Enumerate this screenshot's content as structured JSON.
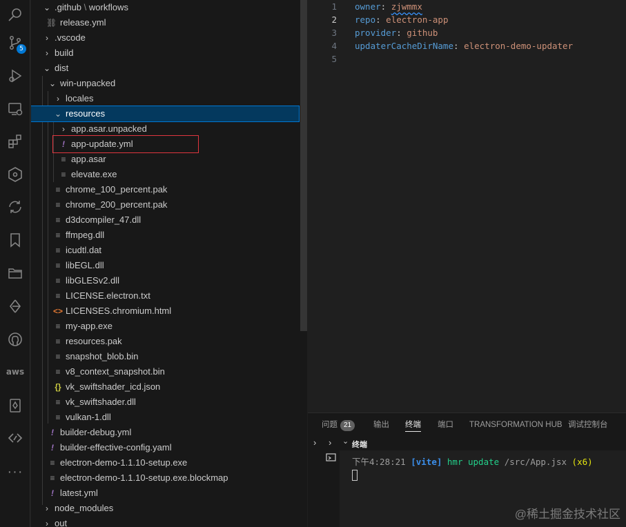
{
  "activity_bar": {
    "scm_badge": "5",
    "aws_label": "aws",
    "more_label": "···"
  },
  "explorer": {
    "rows": [
      {
        "label": ".github",
        "sep": "\\",
        "label2": "workflows",
        "icon": "chevron-down"
      },
      {
        "label": "release.yml",
        "icon": "link"
      },
      {
        "label": ".vscode",
        "icon": "chevron-right"
      },
      {
        "label": "build",
        "icon": "chevron-right"
      },
      {
        "label": "dist",
        "icon": "chevron-down"
      },
      {
        "label": "win-unpacked",
        "icon": "chevron-down"
      },
      {
        "label": "locales",
        "icon": "chevron-right"
      },
      {
        "label": "resources",
        "icon": "chevron-down"
      },
      {
        "label": "app.asar.unpacked",
        "icon": "chevron-right"
      },
      {
        "label": "app-update.yml",
        "icon": "yml"
      },
      {
        "label": "app.asar",
        "icon": "file"
      },
      {
        "label": "elevate.exe",
        "icon": "file"
      },
      {
        "label": "chrome_100_percent.pak",
        "icon": "file"
      },
      {
        "label": "chrome_200_percent.pak",
        "icon": "file"
      },
      {
        "label": "d3dcompiler_47.dll",
        "icon": "file"
      },
      {
        "label": "ffmpeg.dll",
        "icon": "file"
      },
      {
        "label": "icudtl.dat",
        "icon": "file"
      },
      {
        "label": "libEGL.dll",
        "icon": "file"
      },
      {
        "label": "libGLESv2.dll",
        "icon": "file"
      },
      {
        "label": "LICENSE.electron.txt",
        "icon": "file"
      },
      {
        "label": "LICENSES.chromium.html",
        "icon": "html"
      },
      {
        "label": "my-app.exe",
        "icon": "file"
      },
      {
        "label": "resources.pak",
        "icon": "file"
      },
      {
        "label": "snapshot_blob.bin",
        "icon": "file"
      },
      {
        "label": "v8_context_snapshot.bin",
        "icon": "file"
      },
      {
        "label": "vk_swiftshader_icd.json",
        "icon": "json"
      },
      {
        "label": "vk_swiftshader.dll",
        "icon": "file"
      },
      {
        "label": "vulkan-1.dll",
        "icon": "file"
      },
      {
        "label": "builder-debug.yml",
        "icon": "yml"
      },
      {
        "label": "builder-effective-config.yaml",
        "icon": "yml"
      },
      {
        "label": "electron-demo-1.1.10-setup.exe",
        "icon": "file"
      },
      {
        "label": "electron-demo-1.1.10-setup.exe.blockmap",
        "icon": "file"
      },
      {
        "label": "latest.yml",
        "icon": "yml"
      },
      {
        "label": "node_modules",
        "icon": "chevron-right"
      },
      {
        "label": "out",
        "icon": "chevron-right"
      }
    ]
  },
  "editor": {
    "lines": [
      {
        "num": "1",
        "key": "owner",
        "value": "zjwmmx"
      },
      {
        "num": "2",
        "key": "repo",
        "value": "electron-app"
      },
      {
        "num": "3",
        "key": "provider",
        "value": "github"
      },
      {
        "num": "4",
        "key": "updaterCacheDirName",
        "value": "electron-demo-updater"
      },
      {
        "num": "5",
        "key": "",
        "value": ""
      }
    ]
  },
  "panel": {
    "tabs": {
      "problems": "问题",
      "problems_count": "21",
      "output": "输出",
      "terminal": "终端",
      "ports": "端口",
      "transformation_hub": "TRANSFORMATION HUB",
      "debug_console": "调试控制台"
    },
    "terminal_section": "终端",
    "terminal_line": {
      "time": "下午4:28:21",
      "tag": "[vite]",
      "action": "hmr update",
      "path": "/src/App.jsx",
      "count": "(x6)"
    }
  },
  "watermark": "@稀土掘金技术社区"
}
